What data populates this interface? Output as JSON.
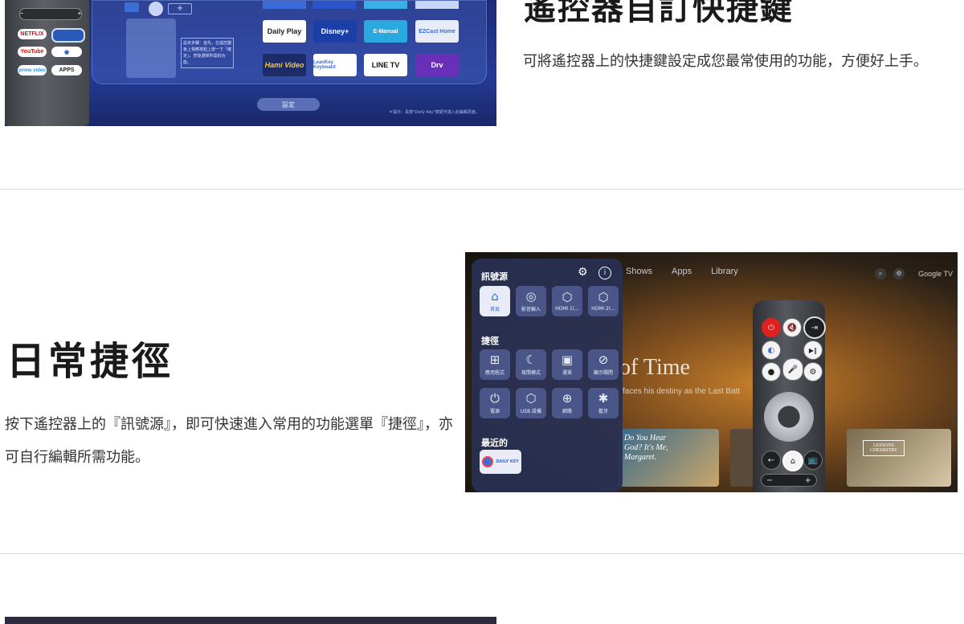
{
  "top": {
    "heading": "遙控器自訂快捷鍵",
    "description": "可將遙控器上的快捷鍵設定成您最常使用的功能，方便好上手。",
    "image": {
      "remote_buttons": [
        "NETFLIX",
        "YouTube",
        "prime video",
        "APPS"
      ],
      "remote_plus": "+",
      "remote_minus": "−",
      "tiles": [
        "Daily Play",
        "Disney+",
        "E-Manual",
        "EZCast Home",
        "Hami Video",
        "LeanKey Keyboard",
        "LINE TV",
        "Drv"
      ],
      "note": "設定步驟：首先，在遙控器板上相應按鈕上按一下「確定」，然後選擇所需的功能。",
      "settings_button": "設定",
      "footnote": "＊提示：長按\"Daily Key\"按鈕可進入此編輯頁面。"
    }
  },
  "middle": {
    "heading": "日常捷徑",
    "description": "按下遙控器上的『訊號源』，即可快速進入常用的功能選單『捷徑』，亦可自行編輯所需功能。",
    "image": {
      "nav": [
        "Shows",
        "Apps",
        "Library"
      ],
      "google_label": "Google TV",
      "hero_title": "of Time",
      "hero_subtitle": "faces his destiny as the Last Batt",
      "panel": {
        "source_title": "訊號源",
        "sources": [
          {
            "icon": "⌂",
            "label": "首頁"
          },
          {
            "icon": "◎",
            "label": "影音輸入"
          },
          {
            "icon": "⬡",
            "label": "HDMI 1(..."
          },
          {
            "icon": "⬡",
            "label": "HDMI 2(..."
          }
        ],
        "shortcut_title": "捷徑",
        "shortcuts": [
          {
            "icon": "⊞",
            "label": "應用程式"
          },
          {
            "icon": "☾",
            "label": "夜間模式"
          },
          {
            "icon": "▣",
            "label": "選單"
          },
          {
            "icon": "⊘",
            "label": "顯示關閉"
          },
          {
            "icon": "⏻",
            "label": "電源"
          },
          {
            "icon": "⬡",
            "label": "USB 設備"
          },
          {
            "icon": "⊕",
            "label": "網路"
          },
          {
            "icon": "✱",
            "label": "藍牙"
          }
        ],
        "recent_title": "最近的",
        "recent_item": "DAILY KEY"
      },
      "card_texts": [
        "Do You Hear God? It's Me, Margaret.",
        "LESSONS CHEMISTRY"
      ],
      "remote_plus": "+",
      "remote_minus": "−"
    }
  },
  "colors": {
    "divider": "#dcdcdc",
    "heading": "#1a1a1a",
    "body_text": "#333333"
  }
}
